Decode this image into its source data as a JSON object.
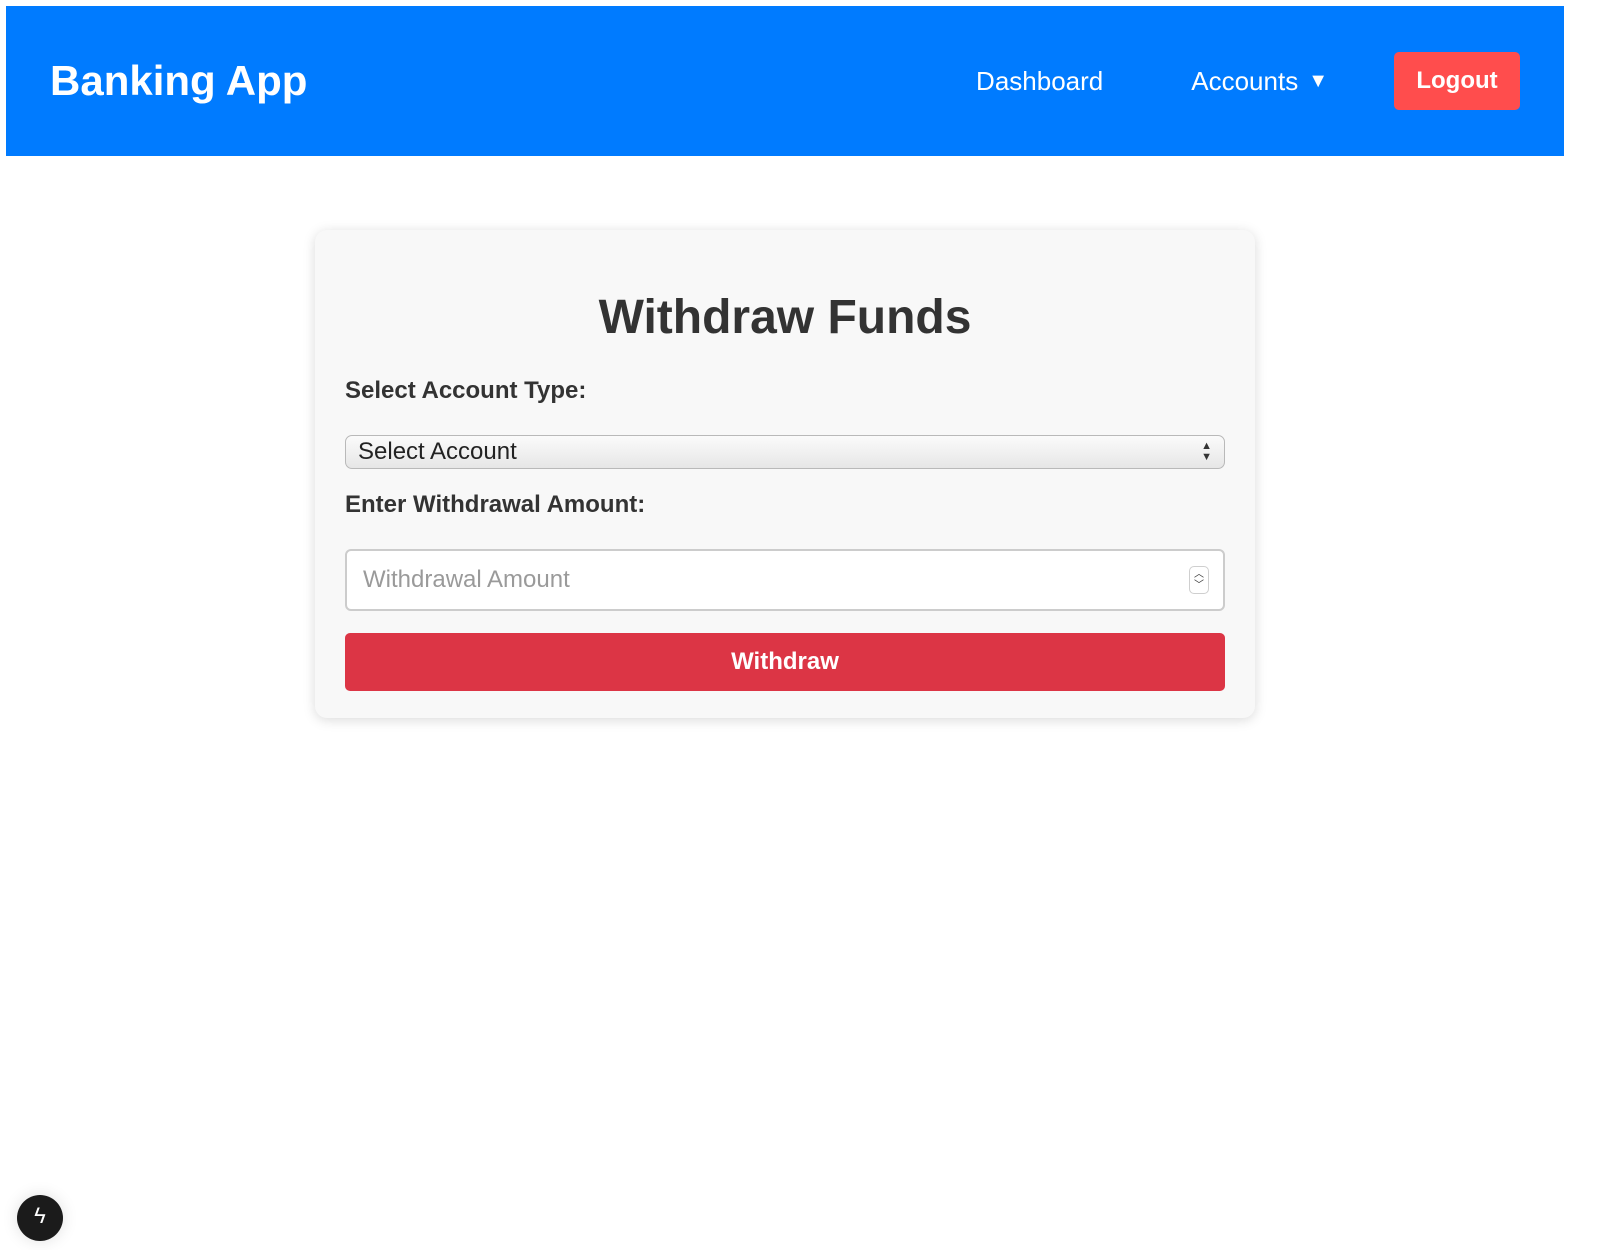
{
  "navbar": {
    "brand": "Banking App",
    "links": [
      {
        "label": "Dashboard"
      },
      {
        "label": "Accounts",
        "caret": "▼"
      }
    ],
    "logout_label": "Logout"
  },
  "form": {
    "title": "Withdraw Funds",
    "account_label": "Select Account Type:",
    "account_select": {
      "selected": "Select Account"
    },
    "amount_label": "Enter Withdrawal Amount:",
    "amount_input": {
      "placeholder": "Withdrawal Amount",
      "value": ""
    },
    "submit_label": "Withdraw"
  },
  "colors": {
    "navbar_bg": "#007bff",
    "logout_bg": "#ff4d4d",
    "withdraw_bg": "#dc3545",
    "card_bg": "#f8f8f8"
  },
  "fab": {
    "icon": "lightning-icon",
    "glyph": "ϟ"
  }
}
